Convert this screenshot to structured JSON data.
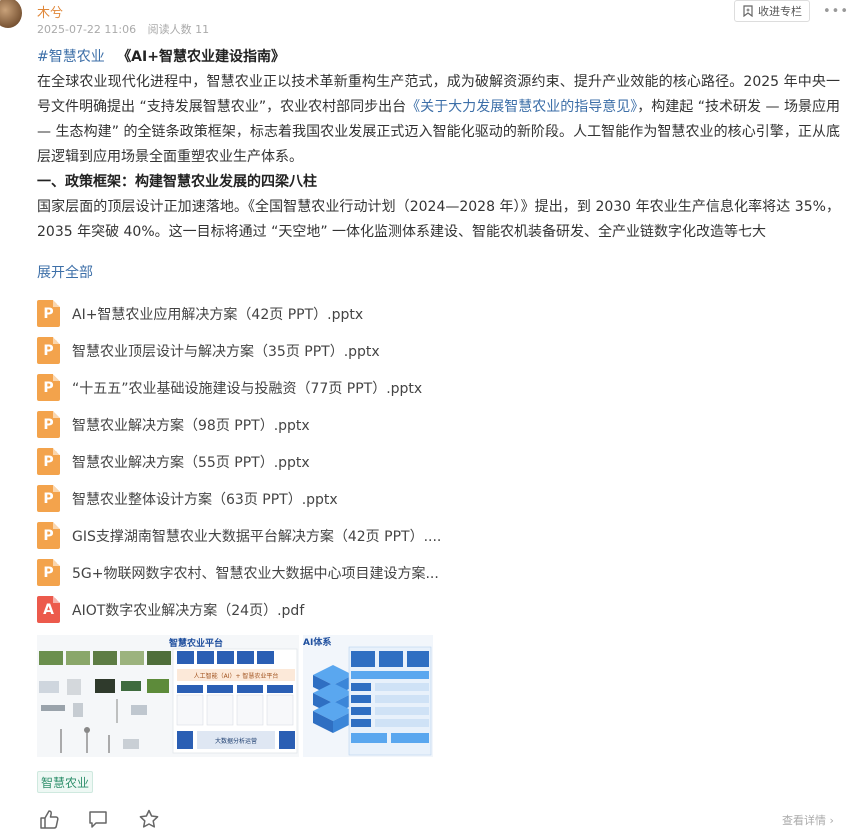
{
  "header": {
    "author": "木兮",
    "date": "2025-07-22 11:06",
    "read_count": "阅读人数 11",
    "collect_label": "收进专栏",
    "collect_icon": "bookmark-icon",
    "more_icon": "more-dots-icon"
  },
  "article": {
    "hashtag": "#智慧农业",
    "title": "《AI+智慧农业建设指南》",
    "p1_part1": "在全球农业现代化进程中，智慧农业正以技术革新重构生产范式，成为破解资源约束、提升产业效能的核心路径。2025 年中央一号文件明确提出 “支持发展智慧农业”，农业农村部同步出台",
    "p1_link": "《关于大力发展智慧农业的指导意见》",
    "p1_part2": "，构建起 “技术研发 — 场景应用 — 生态构建” 的全链条政策框架，标志着我国农业发展正式迈入智能化驱动的新阶段。人工智能作为智慧农业的核心引擎，正从底层逻辑到应用场景全面重塑农业生产体系。",
    "section_title": "一、政策框架：构建智慧农业发展的四梁八柱",
    "p2": "国家层面的顶层设计正加速落地。《全国智慧农业行动计划（2024—2028 年）》提出，到 2030 年农业生产信息化率将达 35%，2035 年突破 40%。这一目标将通过 “天空地” 一体化监测体系建设、智能农机装备研发、全产业链数字化改造等七大"
  },
  "expand_label": "展开全部",
  "files": [
    {
      "name": "AI+智慧农业应用解决方案（42页 PPT）.pptx",
      "type": "pptx",
      "icon_letter": "P"
    },
    {
      "name": "智慧农业顶层设计与解决方案（35页 PPT）.pptx",
      "type": "pptx",
      "icon_letter": "P"
    },
    {
      "name": "“十五五”农业基础设施建设与投融资（77页 PPT）.pptx",
      "type": "pptx",
      "icon_letter": "P"
    },
    {
      "name": "智慧农业解决方案（98页 PPT）.pptx",
      "type": "pptx",
      "icon_letter": "P"
    },
    {
      "name": "智慧农业解决方案（55页 PPT）.pptx",
      "type": "pptx",
      "icon_letter": "P"
    },
    {
      "name": "智慧农业整体设计方案（63页 PPT）.pptx",
      "type": "pptx",
      "icon_letter": "P"
    },
    {
      "name": "GIS支撑湖南智慧农业大数据平台解决方案（42页 PPT）....",
      "type": "pptx",
      "icon_letter": "P"
    },
    {
      "name": "5G+物联网数字农村、智慧农业大数据中心项目建设方案...",
      "type": "pptx",
      "icon_letter": "P"
    },
    {
      "name": "AIOT数字农业解决方案（24页）.pdf",
      "type": "pdf",
      "icon_letter": "A"
    }
  ],
  "images": {
    "img1": {
      "header": "智慧农业平台",
      "row1": [
        "农业",
        "农机机构",
        "合作社",
        "服务商",
        "客户"
      ],
      "banner": "人工智能（AI）+ 智慧农业平台",
      "bottom": "大数据分析运营"
    },
    "img2": {
      "header": "AI体系"
    }
  },
  "tag": "智慧农业",
  "actions": {
    "like_icon": "thumbs-up-icon",
    "comment_icon": "comment-icon",
    "star_icon": "star-icon"
  },
  "detail_label": "查看详情",
  "colors": {
    "accent_link": "#3d6fa8",
    "author": "#e0883a",
    "pptx": "#f3a34c",
    "pdf": "#ec5a4c",
    "tag_text": "#2e8f6b"
  }
}
